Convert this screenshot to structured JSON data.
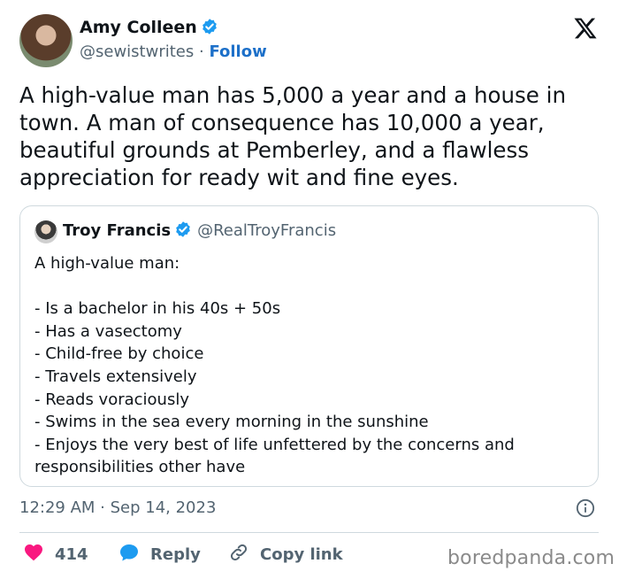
{
  "author": {
    "name": "Amy Colleen",
    "handle": "@sewistwrites",
    "separator": "·",
    "follow_label": "Follow"
  },
  "tweet": {
    "text": "A high-value man has 5,000 a year and a house in town. A man of consequence has 10,000 a year, beautiful grounds at Pemberley, and a flawless appreciation for ready wit and fine eyes."
  },
  "quoted": {
    "name": "Troy Francis",
    "handle": "@RealTroyFrancis",
    "text": "A high-value man:\n\n- Is a bachelor in his 40s + 50s\n- Has a vasectomy\n- Child-free by choice\n- Travels extensively\n- Reads voraciously\n- Swims in the sea every morning in the sunshine\n- Enjoys the very best of life unfettered by the concerns and responsibilities other have"
  },
  "meta": {
    "timestamp": "12:29 AM · Sep 14, 2023"
  },
  "actions": {
    "likes": "414",
    "reply_label": "Reply",
    "copy_link_label": "Copy link"
  },
  "watermark": "boredpanda.com",
  "colors": {
    "verified": "#1d9bf0",
    "like": "#f91880",
    "reply": "#1d9bf0",
    "follow": "#1d70c9"
  },
  "icons": [
    "verified-badge-icon",
    "x-logo-icon",
    "info-icon",
    "heart-icon",
    "reply-bubble-icon",
    "link-icon"
  ]
}
